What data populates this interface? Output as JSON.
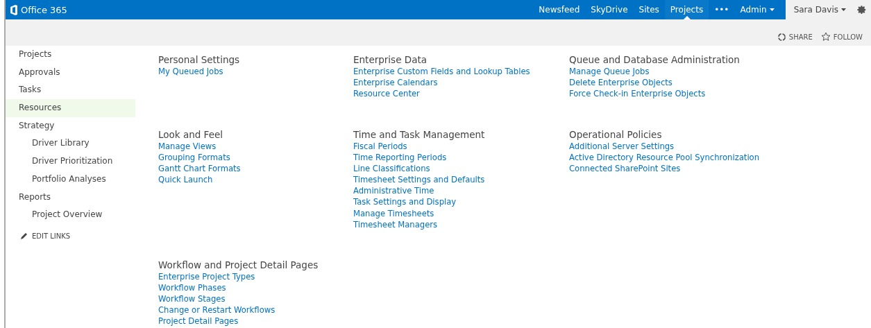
{
  "brand": "Office 365",
  "nav": [
    {
      "label": "Newsfeed",
      "selected": false
    },
    {
      "label": "SkyDrive",
      "selected": false
    },
    {
      "label": "Sites",
      "selected": false
    },
    {
      "label": "Projects",
      "selected": true
    },
    {
      "label": "•••",
      "selected": false
    },
    {
      "label": "Admin",
      "selected": false
    }
  ],
  "user": "Sara Davis",
  "actions": [
    {
      "kind": "share",
      "label": "SHARE"
    },
    {
      "kind": "follow",
      "label": "FOLLOW"
    }
  ],
  "sidebar": {
    "items": [
      {
        "label": "Projects",
        "selected": false
      },
      {
        "label": "Approvals",
        "selected": false
      },
      {
        "label": "Tasks",
        "selected": false
      },
      {
        "label": "Resources",
        "selected": true
      },
      {
        "label": "Strategy",
        "selected": false,
        "children": [
          {
            "label": "Driver Library",
            "selected": false
          },
          {
            "label": "Driver Prioritization",
            "selected": false
          },
          {
            "label": "Portfolio Analyses",
            "selected": false
          }
        ]
      },
      {
        "label": "Reports",
        "selected": false,
        "children": [
          {
            "label": "Project Overview",
            "selected": false
          }
        ]
      }
    ],
    "edit_links": "EDIT LINKS"
  },
  "sections": [
    {
      "title": "Personal Settings",
      "links": [
        "My Queued Jobs"
      ]
    },
    {
      "title": "Enterprise Data",
      "links": [
        "Enterprise Custom Fields and Lookup Tables",
        "Enterprise Calendars",
        "Resource Center"
      ]
    },
    {
      "title": "Queue and Database Administration",
      "links": [
        "Manage Queue Jobs",
        "Delete Enterprise Objects",
        "Force Check-in Enterprise Objects"
      ]
    },
    {
      "title": "Look and Feel",
      "links": [
        "Manage Views",
        "Grouping Formats",
        "Gantt Chart Formats",
        "Quick Launch"
      ]
    },
    {
      "title": "Time and Task Management",
      "links": [
        "Fiscal Periods",
        "Time Reporting Periods",
        "Line Classifications",
        "Timesheet Settings and Defaults",
        "Administrative Time",
        "Task Settings and Display",
        "Manage Timesheets",
        "Timesheet Managers"
      ]
    },
    {
      "title": "Operational Policies",
      "links": [
        "Additional Server Settings",
        "Active Directory Resource Pool Synchronization",
        "Connected SharePoint Sites"
      ]
    },
    {
      "title": "Workflow and Project Detail Pages",
      "links": [
        "Enterprise Project Types",
        "Workflow Phases",
        "Workflow Stages",
        "Change or Restart Workflows",
        "Project Detail Pages"
      ]
    }
  ]
}
